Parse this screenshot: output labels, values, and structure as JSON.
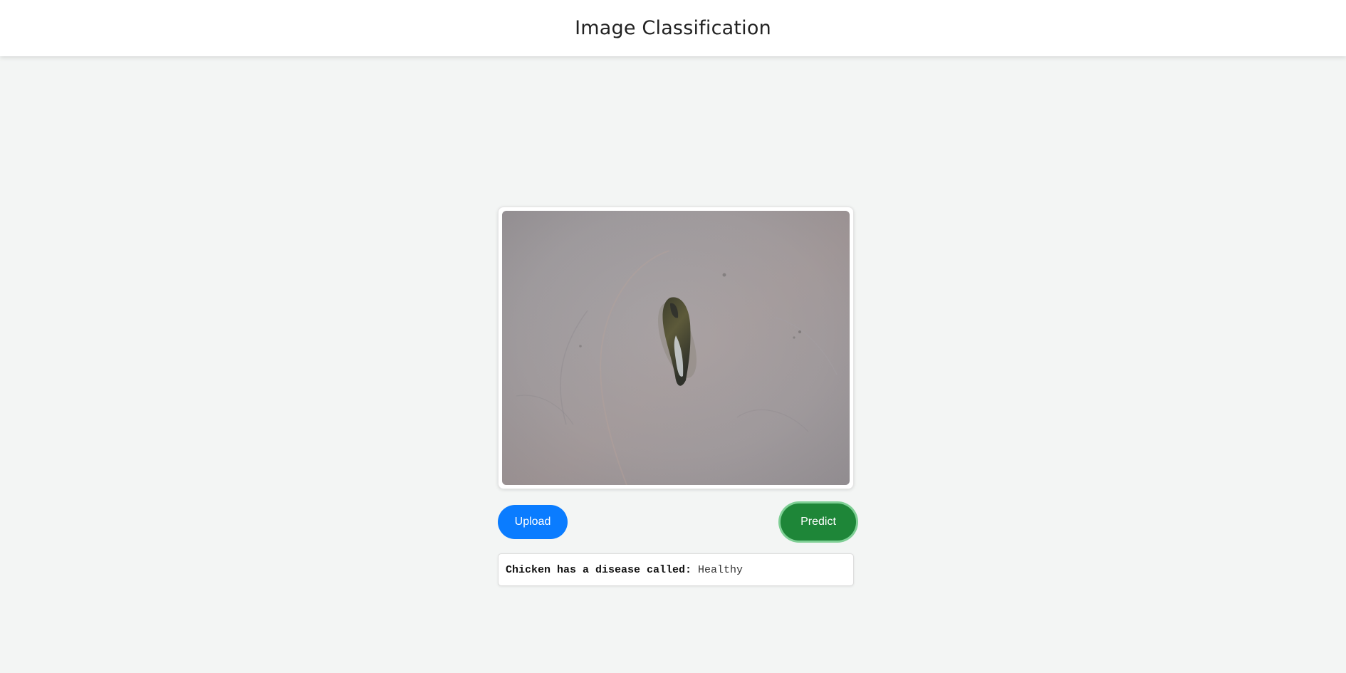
{
  "header": {
    "title": "Image Classification"
  },
  "preview": {
    "icon": "uploaded-image"
  },
  "actions": {
    "upload_label": "Upload",
    "predict_label": "Predict"
  },
  "result": {
    "label": "Chicken has a disease called: ",
    "value": "Healthy"
  },
  "colors": {
    "upload": "#0a7cff",
    "predict": "#1e8638",
    "background": "#f3f5f4"
  }
}
